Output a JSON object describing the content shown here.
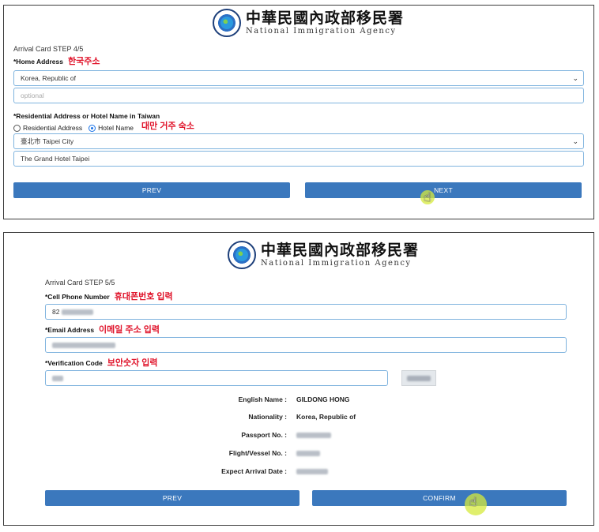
{
  "logo": {
    "title_cn": "中華民國內政部移民署",
    "title_en": "National Immigration Agency"
  },
  "step4": {
    "step_label": "Arrival Card STEP 4/5",
    "home_address": {
      "label": "*Home Address",
      "note": "한국주소",
      "country_value": "Korea, Republic of",
      "detail_placeholder": "optional"
    },
    "residential": {
      "label": "*Residential Address or Hotel Name in Taiwan",
      "note": "대만 거주 숙소",
      "option_residential": "Residential Address",
      "option_hotel": "Hotel Name",
      "selected_option": "Hotel Name",
      "city_value": "臺北市 Taipei City",
      "hotel_value": "The Grand Hotel Taipei"
    },
    "buttons": {
      "prev": "PREV",
      "next": "NEXT"
    }
  },
  "step5": {
    "step_label": "Arrival Card STEP 5/5",
    "phone": {
      "label": "*Cell Phone Number",
      "note": "휴대폰번호 입력",
      "value_prefix": "82"
    },
    "email": {
      "label": "*Email Address",
      "note": "이메일 주소 입력"
    },
    "verification": {
      "label": "*Verification Code",
      "note": "보안숫자 입력"
    },
    "summary": {
      "english_name_label": "English Name :",
      "english_name_value": "GILDONG HONG",
      "nationality_label": "Nationality :",
      "nationality_value": "Korea, Republic of",
      "passport_label": "Passport No. :",
      "flight_label": "Flight/Vessel No. :",
      "arrival_label": "Expect Arrival Date :"
    },
    "buttons": {
      "prev": "PREV",
      "confirm": "CONFIRM"
    }
  },
  "colors": {
    "button": "#3b78bd",
    "note_red": "#e0142b",
    "field_border": "#7fb3de",
    "cursor_highlight": "#d6ea3c"
  },
  "icons": [
    "agency-emblem-icon",
    "chevron-down-icon",
    "hand-pointer-icon"
  ]
}
